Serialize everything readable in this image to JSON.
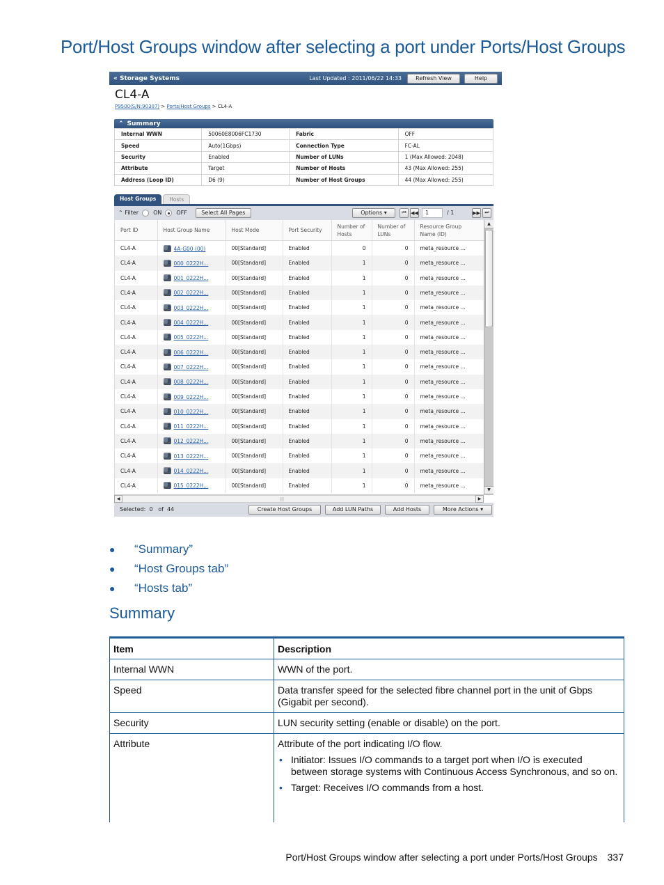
{
  "page_title": "Port/Host Groups window after selecting a port under Ports/Host Groups",
  "app": {
    "topbar": {
      "title": "Storage Systems",
      "last_updated": "Last Updated : 2011/06/22 14:33",
      "refresh_label": "Refresh View",
      "help_label": "Help"
    },
    "port_title": "CL4-A",
    "breadcrumb": [
      "P9500(S/N:90307)",
      "Ports/Host Groups",
      "CL4-A"
    ],
    "breadcrumb_sep": ">",
    "summary": {
      "title": "Summary",
      "rows": [
        {
          "l1": "Internal WWN",
          "v1": "50060E8006FC1730",
          "l2": "Fabric",
          "v2": "OFF"
        },
        {
          "l1": "Speed",
          "v1": "Auto(1Gbps)",
          "l2": "Connection Type",
          "v2": "FC-AL"
        },
        {
          "l1": "Security",
          "v1": "Enabled",
          "l2": "Number of LUNs",
          "v2": "1 (Max Allowed: 2048)"
        },
        {
          "l1": "Attribute",
          "v1": "Target",
          "l2": "Number of Hosts",
          "v2": "43 (Max Allowed: 255)"
        },
        {
          "l1": "Address (Loop ID)",
          "v1": "D6 (9)",
          "l2": "Number of Host Groups",
          "v2": "44 (Max Allowed: 255)"
        }
      ]
    },
    "tabs": [
      "Host Groups",
      "Hosts"
    ],
    "toolbar": {
      "filter_label": "Filter",
      "on_label": "ON",
      "off_label": "OFF",
      "filter_state": "OFF",
      "select_all_label": "Select All Pages",
      "options_label": "Options",
      "page_value": "1",
      "page_total": "/ 1"
    },
    "columns": [
      "Port ID",
      "Host Group Name",
      "Host Mode",
      "Port Security",
      "Number of Hosts",
      "Number of LUNs",
      "Resource Group Name (ID)"
    ],
    "rows": [
      [
        "CL4-A",
        "4A-G00 (00)",
        "00[Standard]",
        "Enabled",
        "0",
        "0",
        "meta_resource ..."
      ],
      [
        "CL4-A",
        "000_0222H...",
        "00[Standard]",
        "Enabled",
        "1",
        "0",
        "meta_resource ..."
      ],
      [
        "CL4-A",
        "001_0222H...",
        "00[Standard]",
        "Enabled",
        "1",
        "0",
        "meta_resource ..."
      ],
      [
        "CL4-A",
        "002_0222H...",
        "00[Standard]",
        "Enabled",
        "1",
        "0",
        "meta_resource ..."
      ],
      [
        "CL4-A",
        "003_0222H...",
        "00[Standard]",
        "Enabled",
        "1",
        "0",
        "meta_resource ..."
      ],
      [
        "CL4-A",
        "004_0222H...",
        "00[Standard]",
        "Enabled",
        "1",
        "0",
        "meta_resource ..."
      ],
      [
        "CL4-A",
        "005_0222H...",
        "00[Standard]",
        "Enabled",
        "1",
        "0",
        "meta_resource ..."
      ],
      [
        "CL4-A",
        "006_0222H...",
        "00[Standard]",
        "Enabled",
        "1",
        "0",
        "meta_resource ..."
      ],
      [
        "CL4-A",
        "007_0222H...",
        "00[Standard]",
        "Enabled",
        "1",
        "0",
        "meta_resource ..."
      ],
      [
        "CL4-A",
        "008_0222H...",
        "00[Standard]",
        "Enabled",
        "1",
        "0",
        "meta_resource ..."
      ],
      [
        "CL4-A",
        "009_0222H...",
        "00[Standard]",
        "Enabled",
        "1",
        "0",
        "meta_resource ..."
      ],
      [
        "CL4-A",
        "010_0222H...",
        "00[Standard]",
        "Enabled",
        "1",
        "0",
        "meta_resource ..."
      ],
      [
        "CL4-A",
        "011_0222H...",
        "00[Standard]",
        "Enabled",
        "1",
        "0",
        "meta_resource ..."
      ],
      [
        "CL4-A",
        "012_0222H...",
        "00[Standard]",
        "Enabled",
        "1",
        "0",
        "meta_resource ..."
      ],
      [
        "CL4-A",
        "013_0222H...",
        "00[Standard]",
        "Enabled",
        "1",
        "0",
        "meta_resource ..."
      ],
      [
        "CL4-A",
        "014_0222H...",
        "00[Standard]",
        "Enabled",
        "1",
        "0",
        "meta_resource ..."
      ],
      [
        "CL4-A",
        "015_0222H...",
        "00[Standard]",
        "Enabled",
        "1",
        "0",
        "meta_resource ..."
      ]
    ],
    "footer": {
      "selected_label": "Selected:",
      "selected_count": "0",
      "of_label": "of",
      "total": "44",
      "create_label": "Create Host Groups",
      "add_lun_label": "Add LUN Paths",
      "add_hosts_label": "Add Hosts",
      "more_label": "More Actions"
    }
  },
  "links": [
    "“Summary”",
    "“Host Groups tab”",
    "“Hosts tab”"
  ],
  "section_heading": "Summary",
  "doc_table": {
    "headers": [
      "Item",
      "Description"
    ],
    "rows": [
      {
        "item": "Internal WWN",
        "desc": "WWN of the port."
      },
      {
        "item": "Speed",
        "desc": "Data transfer speed for the selected fibre channel port in the unit of Gbps (Gigabit per second)."
      },
      {
        "item": "Security",
        "desc": "LUN security setting (enable or disable) on the port."
      },
      {
        "item": "Attribute",
        "desc": "Attribute of the port indicating I/O flow.",
        "bullets": [
          "Initiator: Issues I/O commands to a target port when I/O is executed between storage systems with Continuous Access Synchronous, and so on.",
          "Target: Receives I/O commands from a host."
        ]
      }
    ]
  },
  "footer": {
    "text": "Port/Host Groups window after selecting a port under Ports/Host Groups",
    "page_number": "337"
  }
}
